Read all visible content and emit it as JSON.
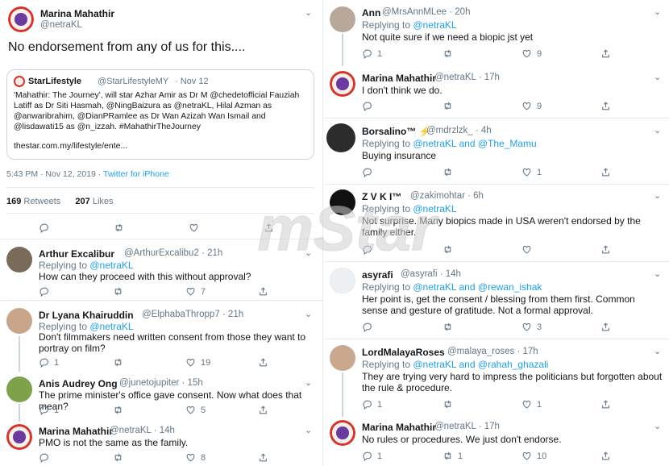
{
  "main_tweet": {
    "name": "Marina Mahathir",
    "handle": "@netraKL",
    "text": "No endorsement from any of us for this....",
    "quote": {
      "name": "StarLifestyle",
      "handle": "@StarLifestyleMY",
      "date": "· Nov 12",
      "text": "'Mahathir: The Journey', will star Azhar Amir as Dr M @chedetofficial Fauziah Latiff as Dr Siti Hasmah, @NingBaizura as @netraKL, Hilal Azman as @anwaribrahim, @DianPRamlee as Dr Wan Azizah Wan Ismail and @lisdawati15 as @n_izzah. #MahathirTheJourney",
      "link": "thestar.com.my/lifestyle/ente..."
    },
    "timestamp": "5:43 PM · Nov 12, 2019 · ",
    "source": "Twitter for iPhone",
    "retweets_count": "169",
    "retweets_label": "Retweets",
    "likes_count": "207",
    "likes_label": "Likes"
  },
  "left_replies": [
    {
      "name": "Arthur Excalibur",
      "handle": "@ArthurExcalibu2 · 21h",
      "replying": "Replying to ",
      "to": "@netraKL",
      "text": "How can they proceed with this without approval?",
      "replies": "",
      "retweets": "",
      "likes": "7"
    },
    {
      "name": "Dr Lyana Khairuddin",
      "handle": "@ElphabaThropp7 · 21h",
      "replying": "Replying to ",
      "to": "@netraKL",
      "text": "Don't filmmakers need written consent from those they want to portray on film?",
      "replies": "1",
      "retweets": "",
      "likes": "19"
    },
    {
      "name": "Anis Audrey Ong",
      "handle": "@junetojupiter · 15h",
      "text": "The prime minister's office gave consent. Now what does that mean?",
      "replies": "1",
      "retweets": "",
      "likes": "5"
    },
    {
      "name": "Marina Mahathir",
      "handle": "@netraKL · 14h",
      "text": "PMO is not the same as the family.",
      "replies": "",
      "retweets": "",
      "likes": "8"
    }
  ],
  "right_replies": [
    {
      "name": "Ann",
      "handle": "@MrsAnnMLee · 20h",
      "replying": "Replying to ",
      "to": "@netraKL",
      "text": "Not quite sure if we need  a biopic jst yet",
      "replies": "1",
      "retweets": "",
      "likes": "9"
    },
    {
      "name": "Marina Mahathir",
      "handle": "@netraKL · 17h",
      "text": "I don't think we do.",
      "replies": "",
      "retweets": "",
      "likes": "9"
    },
    {
      "name": "Borsalino™ ⚡",
      "handle": "@mdrzlzk_ · 4h",
      "replying": "Replying to ",
      "to": "@netraKL and @The_Mamu",
      "text": "Buying insurance",
      "replies": "",
      "retweets": "",
      "likes": "1"
    },
    {
      "name": "Z V K I™",
      "handle": "@zakimohtar · 6h",
      "replying": "Replying to ",
      "to": "@netraKL",
      "text": "Not surprise. Many biopics made in USA weren't endorsed by the family either.",
      "replies": "",
      "retweets": "",
      "likes": ""
    },
    {
      "name": "asyrafi",
      "handle": "@asyrafi · 14h",
      "replying": "Replying to ",
      "to": "@netraKL and @rewan_ishak",
      "text": "Her point is, get the consent / blessing from them first. Common sense and gesture of gratitude. Not a formal approval.",
      "replies": "",
      "retweets": "",
      "likes": "3"
    },
    {
      "name": "LordMalayaRoses",
      "handle": "@malaya_roses · 17h",
      "replying": "Replying to ",
      "to": "@netraKL and @rahah_ghazali",
      "text": "They are trying very hard to impress the politicians but forgotten about the rule & procedure.",
      "replies": "1",
      "retweets": "",
      "likes": "1"
    },
    {
      "name": "Marina Mahathir",
      "handle": "@netraKL · 17h",
      "text": "No rules or procedures. We just don't endorse.",
      "replies": "1",
      "retweets": "1",
      "likes": "10"
    }
  ],
  "watermark": {
    "brand": "mStar"
  },
  "colors": {
    "link": "#1da1f2",
    "muted": "#657786",
    "border": "#e6ecf0"
  },
  "icons": [
    "reply-icon",
    "retweet-icon",
    "like-icon",
    "share-icon",
    "chevron-down-icon"
  ]
}
